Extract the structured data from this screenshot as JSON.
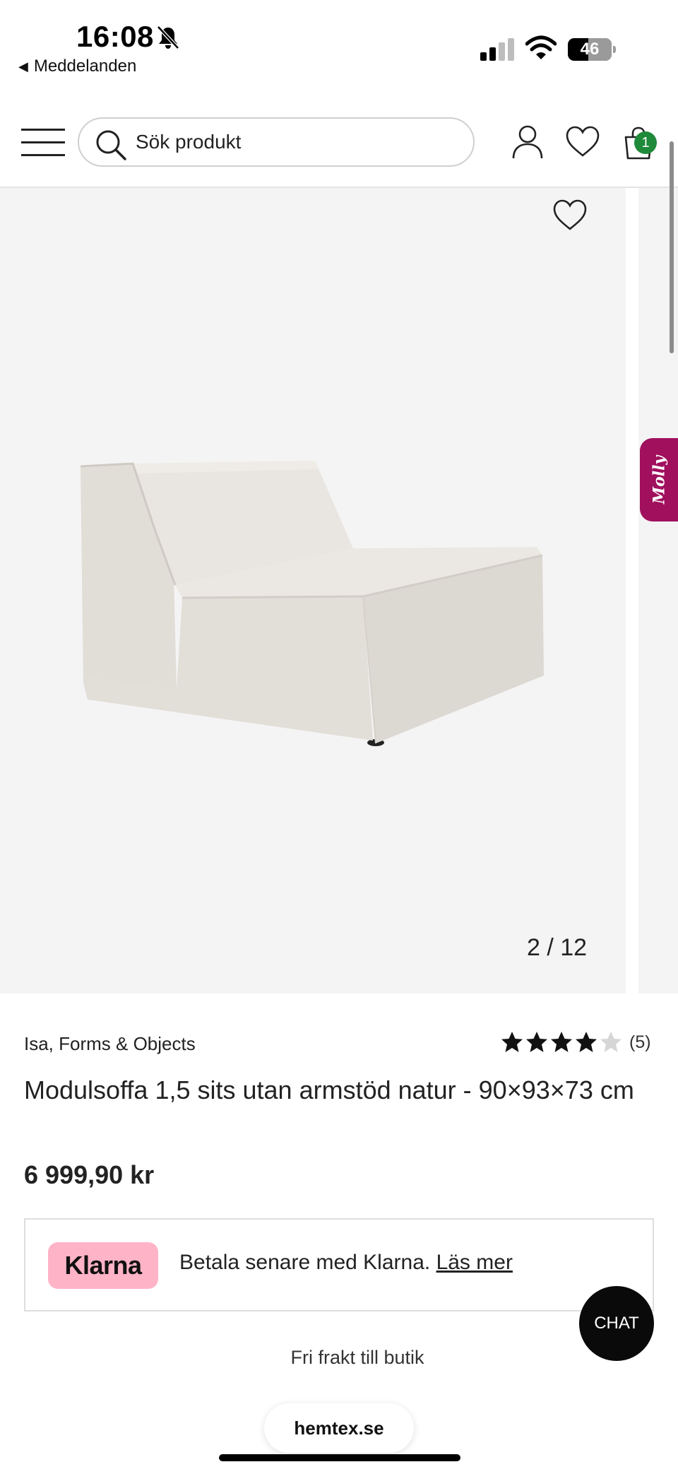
{
  "status_bar": {
    "time": "16:08",
    "back_app": "Meddelanden",
    "battery": "46",
    "battery_level": 0.46
  },
  "header": {
    "search_placeholder": "Sök produkt",
    "cart_count": "1"
  },
  "gallery": {
    "counter": "2 / 12",
    "chat_bot_label": "Molly"
  },
  "product": {
    "brand": "Isa, Forms & Objects",
    "rating_value": 4,
    "rating_max": 5,
    "rating_count": "(5)",
    "title": "Modulsoffa 1,5 sits utan armstöd natur - 90×93×73 cm",
    "price": "6 999,90 kr"
  },
  "klarna": {
    "logo": "Klarna",
    "text": "Betala senare med Klarna.",
    "link": "Läs mer",
    "brand_color": "#ffb3c7"
  },
  "chat": {
    "label": "CHAT"
  },
  "shipping": "Fri frakt till butik",
  "browser": {
    "url": "hemtex.se"
  },
  "colors": {
    "accent_green": "#1f8a3a",
    "chat_bot": "#a0105d"
  },
  "icons": [
    "bell-off-icon",
    "signal-icon",
    "wifi-icon",
    "menu-icon",
    "search-icon",
    "account-icon",
    "wishlist-icon",
    "cart-icon",
    "star-icon"
  ]
}
